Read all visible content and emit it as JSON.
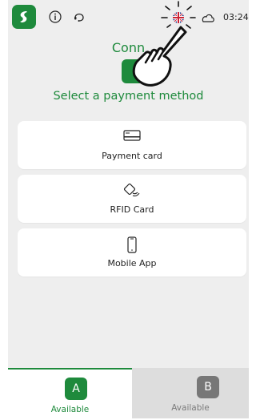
{
  "status_bar": {
    "time": "03:24",
    "icons": [
      "app-logo-icon",
      "info-icon",
      "support-headset-icon",
      "uk-flag-icon",
      "cloud-icon"
    ]
  },
  "connect": {
    "title": "Conn",
    "subtitle": "Select a payment method"
  },
  "methods": [
    {
      "label": "Payment card",
      "icon": "credit-card-icon"
    },
    {
      "label": "RFID Card",
      "icon": "rfid-card-icon"
    },
    {
      "label": "Mobile App",
      "icon": "smartphone-icon"
    }
  ],
  "tabs": [
    {
      "badge": "A",
      "status": "Available"
    },
    {
      "badge": "B",
      "status": "Available"
    }
  ],
  "colors": {
    "accent": "#1e8a3c",
    "background": "#eeeeee",
    "card": "#ffffff",
    "inactive_tab": "#dddddd"
  }
}
